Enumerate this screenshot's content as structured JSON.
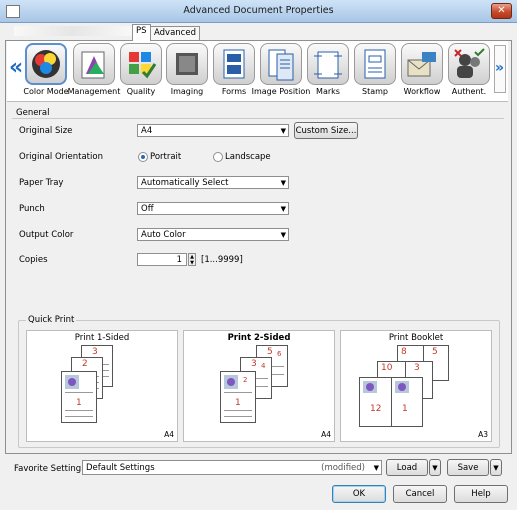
{
  "window": {
    "title": "Advanced Document Properties",
    "close_label": "✕"
  },
  "tabs": [
    {
      "label": "PS"
    },
    {
      "label": "Advanced"
    }
  ],
  "features": [
    {
      "label": "Color Mode",
      "icon": "color-mode-icon"
    },
    {
      "label": "Management",
      "icon": "management-icon"
    },
    {
      "label": "Quality",
      "icon": "quality-icon"
    },
    {
      "label": "Imaging",
      "icon": "imaging-icon"
    },
    {
      "label": "Forms",
      "icon": "forms-icon"
    },
    {
      "label": "Image Position",
      "icon": "image-position-icon"
    },
    {
      "label": "Marks",
      "icon": "marks-icon"
    },
    {
      "label": "Stamp",
      "icon": "stamp-icon"
    },
    {
      "label": "Workflow",
      "icon": "workflow-icon"
    },
    {
      "label": "Authent.",
      "icon": "authentication-icon"
    }
  ],
  "general": {
    "title": "General",
    "original_size": {
      "label": "Original Size",
      "value": "A4",
      "custom_button": "Custom Size..."
    },
    "orientation": {
      "label": "Original Orientation",
      "portrait": "Portrait",
      "landscape": "Landscape",
      "selected": "Portrait"
    },
    "paper_tray": {
      "label": "Paper Tray",
      "value": "Automatically Select"
    },
    "punch": {
      "label": "Punch",
      "value": "Off"
    },
    "output_color": {
      "label": "Output Color",
      "value": "Auto Color"
    },
    "copies": {
      "label": "Copies",
      "value": "1",
      "range": "[1...9999]"
    }
  },
  "quick_print": {
    "title": "Quick Print",
    "cards": [
      {
        "title": "Print 1-Sided",
        "size": "A4",
        "pages": [
          "3",
          "2",
          "1"
        ]
      },
      {
        "title": "Print 2-Sided",
        "size": "A4",
        "pages": [
          "5",
          "6",
          "3",
          "4",
          "1",
          "2"
        ]
      },
      {
        "title": "Print Booklet",
        "size": "A3",
        "pages": [
          "8",
          "5",
          "10",
          "3",
          "12",
          "1"
        ]
      }
    ]
  },
  "favorite": {
    "label": "Favorite Setting",
    "value": "Default Settings",
    "status": "(modified)",
    "load": "Load",
    "save": "Save"
  },
  "buttons": {
    "ok": "OK",
    "cancel": "Cancel",
    "help": "Help"
  },
  "colors": {
    "accent": "#2f66b3",
    "titlebar": "#b9d3ee",
    "close": "#c94a2c",
    "nav_arrow": "#1f6cc1"
  }
}
